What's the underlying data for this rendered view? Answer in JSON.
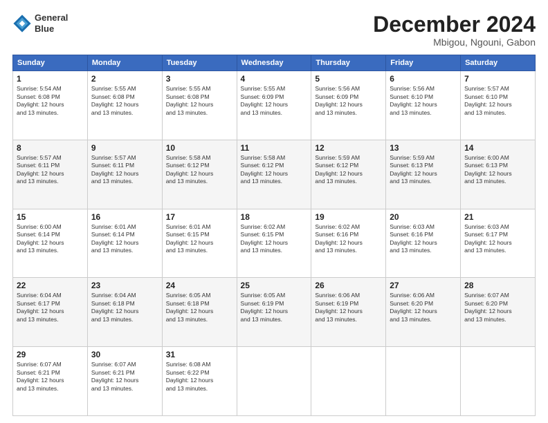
{
  "logo": {
    "line1": "General",
    "line2": "Blue"
  },
  "header": {
    "month": "December 2024",
    "location": "Mbigou, Ngouni, Gabon"
  },
  "weekdays": [
    "Sunday",
    "Monday",
    "Tuesday",
    "Wednesday",
    "Thursday",
    "Friday",
    "Saturday"
  ],
  "weeks": [
    [
      {
        "day": "1",
        "info": "Sunrise: 5:54 AM\nSunset: 6:08 PM\nDaylight: 12 hours\nand 13 minutes."
      },
      {
        "day": "2",
        "info": "Sunrise: 5:55 AM\nSunset: 6:08 PM\nDaylight: 12 hours\nand 13 minutes."
      },
      {
        "day": "3",
        "info": "Sunrise: 5:55 AM\nSunset: 6:08 PM\nDaylight: 12 hours\nand 13 minutes."
      },
      {
        "day": "4",
        "info": "Sunrise: 5:55 AM\nSunset: 6:09 PM\nDaylight: 12 hours\nand 13 minutes."
      },
      {
        "day": "5",
        "info": "Sunrise: 5:56 AM\nSunset: 6:09 PM\nDaylight: 12 hours\nand 13 minutes."
      },
      {
        "day": "6",
        "info": "Sunrise: 5:56 AM\nSunset: 6:10 PM\nDaylight: 12 hours\nand 13 minutes."
      },
      {
        "day": "7",
        "info": "Sunrise: 5:57 AM\nSunset: 6:10 PM\nDaylight: 12 hours\nand 13 minutes."
      }
    ],
    [
      {
        "day": "8",
        "info": "Sunrise: 5:57 AM\nSunset: 6:11 PM\nDaylight: 12 hours\nand 13 minutes."
      },
      {
        "day": "9",
        "info": "Sunrise: 5:57 AM\nSunset: 6:11 PM\nDaylight: 12 hours\nand 13 minutes."
      },
      {
        "day": "10",
        "info": "Sunrise: 5:58 AM\nSunset: 6:12 PM\nDaylight: 12 hours\nand 13 minutes."
      },
      {
        "day": "11",
        "info": "Sunrise: 5:58 AM\nSunset: 6:12 PM\nDaylight: 12 hours\nand 13 minutes."
      },
      {
        "day": "12",
        "info": "Sunrise: 5:59 AM\nSunset: 6:12 PM\nDaylight: 12 hours\nand 13 minutes."
      },
      {
        "day": "13",
        "info": "Sunrise: 5:59 AM\nSunset: 6:13 PM\nDaylight: 12 hours\nand 13 minutes."
      },
      {
        "day": "14",
        "info": "Sunrise: 6:00 AM\nSunset: 6:13 PM\nDaylight: 12 hours\nand 13 minutes."
      }
    ],
    [
      {
        "day": "15",
        "info": "Sunrise: 6:00 AM\nSunset: 6:14 PM\nDaylight: 12 hours\nand 13 minutes."
      },
      {
        "day": "16",
        "info": "Sunrise: 6:01 AM\nSunset: 6:14 PM\nDaylight: 12 hours\nand 13 minutes."
      },
      {
        "day": "17",
        "info": "Sunrise: 6:01 AM\nSunset: 6:15 PM\nDaylight: 12 hours\nand 13 minutes."
      },
      {
        "day": "18",
        "info": "Sunrise: 6:02 AM\nSunset: 6:15 PM\nDaylight: 12 hours\nand 13 minutes."
      },
      {
        "day": "19",
        "info": "Sunrise: 6:02 AM\nSunset: 6:16 PM\nDaylight: 12 hours\nand 13 minutes."
      },
      {
        "day": "20",
        "info": "Sunrise: 6:03 AM\nSunset: 6:16 PM\nDaylight: 12 hours\nand 13 minutes."
      },
      {
        "day": "21",
        "info": "Sunrise: 6:03 AM\nSunset: 6:17 PM\nDaylight: 12 hours\nand 13 minutes."
      }
    ],
    [
      {
        "day": "22",
        "info": "Sunrise: 6:04 AM\nSunset: 6:17 PM\nDaylight: 12 hours\nand 13 minutes."
      },
      {
        "day": "23",
        "info": "Sunrise: 6:04 AM\nSunset: 6:18 PM\nDaylight: 12 hours\nand 13 minutes."
      },
      {
        "day": "24",
        "info": "Sunrise: 6:05 AM\nSunset: 6:18 PM\nDaylight: 12 hours\nand 13 minutes."
      },
      {
        "day": "25",
        "info": "Sunrise: 6:05 AM\nSunset: 6:19 PM\nDaylight: 12 hours\nand 13 minutes."
      },
      {
        "day": "26",
        "info": "Sunrise: 6:06 AM\nSunset: 6:19 PM\nDaylight: 12 hours\nand 13 minutes."
      },
      {
        "day": "27",
        "info": "Sunrise: 6:06 AM\nSunset: 6:20 PM\nDaylight: 12 hours\nand 13 minutes."
      },
      {
        "day": "28",
        "info": "Sunrise: 6:07 AM\nSunset: 6:20 PM\nDaylight: 12 hours\nand 13 minutes."
      }
    ],
    [
      {
        "day": "29",
        "info": "Sunrise: 6:07 AM\nSunset: 6:21 PM\nDaylight: 12 hours\nand 13 minutes."
      },
      {
        "day": "30",
        "info": "Sunrise: 6:07 AM\nSunset: 6:21 PM\nDaylight: 12 hours\nand 13 minutes."
      },
      {
        "day": "31",
        "info": "Sunrise: 6:08 AM\nSunset: 6:22 PM\nDaylight: 12 hours\nand 13 minutes."
      },
      {
        "day": "",
        "info": ""
      },
      {
        "day": "",
        "info": ""
      },
      {
        "day": "",
        "info": ""
      },
      {
        "day": "",
        "info": ""
      }
    ]
  ]
}
